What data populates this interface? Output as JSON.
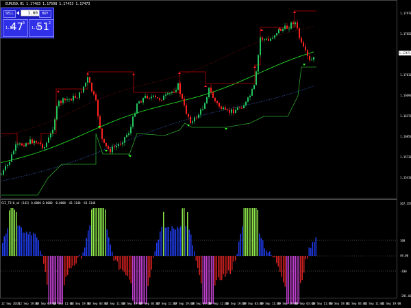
{
  "symbol_header": "EURUSD,H1  1.17483 1.17508 1.17453 1.17473",
  "trade_panel": {
    "sell_label": "SELL",
    "buy_label": "BUY",
    "lot_value": "1.00",
    "bid_prefix": "1.17",
    "bid_big": "47",
    "bid_sup": "3",
    "ask_prefix": "1.17",
    "ask_big": "51",
    "ask_sup": "2"
  },
  "price_axis": [
    "1.17970",
    "1.17650",
    "1.17330",
    "1.17010",
    "1.16690",
    "1.16370",
    "1.16050",
    "1.15730",
    "1.15410"
  ],
  "current_price_tag": "1.17473",
  "oscillator_header": "CCI_T3(0_n4 (143) 0.0000 0.0000 -0.0000 -43.1148 -43.1148",
  "oscillator_axis": [
    "367.3593",
    "100",
    "49.00",
    "-100",
    "-291.6072"
  ],
  "time_axis": [
    "12 Sep 2018",
    "12 Sep 19:00",
    "13 Sep 03:00",
    "13 Sep 11:00",
    "13 Sep 19:00",
    "14 Sep 03:00",
    "14 Sep 11:00",
    "14 Sep 19:00",
    "17 Sep 03:00",
    "17 Sep 11:00",
    "17 Sep 19:00",
    "18 Sep 03:00",
    "18 Sep 11:00",
    "18 Sep 19:00",
    "19 Sep 03:00",
    "19 Sep 11:00",
    "19 Sep 19:00",
    "20 Sep 03:00",
    "20 Sep 11:00",
    "20 Sep 19:00",
    "21 Sep 03:00",
    "21 Sep 11:00",
    "21 Sep 19:00"
  ],
  "colors": {
    "bull_candle": "#22c55e",
    "bear_candle": "#ff2020",
    "green_ma": "#22dd22",
    "red_trail": "#c00000",
    "blue_dots": "#3a6bd6",
    "support_line": "#2ea82e",
    "osc_blue": "#1f3df0",
    "osc_green": "#8ee84a",
    "osc_red": "#d22020",
    "osc_magenta": "#c040d0"
  }
}
